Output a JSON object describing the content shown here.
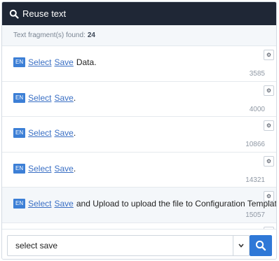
{
  "header": {
    "title": "Reuse text",
    "icon": "search-icon"
  },
  "found": {
    "label": "Text fragment(s) found:",
    "count": "24"
  },
  "rows": [
    {
      "lang": "EN",
      "link1": "Select",
      "link2": "Save",
      "text": "Data.",
      "id": "3585"
    },
    {
      "lang": "EN",
      "link1": "Select",
      "link2": "Save",
      "text": ".",
      "id": "4000"
    },
    {
      "lang": "EN",
      "link1": "Select",
      "link2": "Save",
      "text": ".",
      "id": "10866"
    },
    {
      "lang": "EN",
      "link1": "Select",
      "link2": "Save",
      "text": ".",
      "id": "14321"
    },
    {
      "lang": "EN",
      "link1": "Select",
      "link2": "Save",
      "text": "and Upload to upload the file to Configuration Templates .",
      "id": "15057"
    }
  ],
  "search": {
    "value": "select save"
  },
  "colors": {
    "header_bg": "#1f2736",
    "accent": "#2f78d7",
    "lang_badge": "#3c7fd6",
    "link": "#3a6fc4"
  }
}
